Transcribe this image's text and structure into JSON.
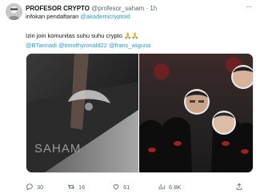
{
  "tweet": {
    "display_name": "PROFESOR CRYPTO",
    "handle": "@profesor_saham",
    "separator": "·",
    "time": "1h",
    "more_label": "···",
    "line1_prefix": "infokan pendaftaran ",
    "line1_link": "@akademicryptoid",
    "line2": "Izin join komunitas suhu suhu crypto 🙏🙏",
    "mentions": [
      "@BTannadi",
      "@timothyronald22",
      "@frans_wiguna"
    ],
    "media_left_text": "SAHAM"
  },
  "actions": {
    "reply_count": "30",
    "retweet_count": "16",
    "like_count": "61",
    "views_count": "6.8K"
  },
  "colors": {
    "link": "#1d9bf0",
    "muted": "#536471",
    "text": "#0f1419"
  }
}
